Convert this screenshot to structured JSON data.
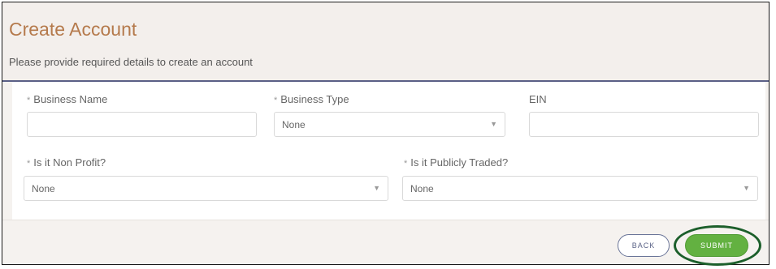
{
  "header": {
    "title": "Create Account",
    "subtitle": "Please provide required details to create an account"
  },
  "form": {
    "required_marker": "*",
    "business_name": {
      "label": "Business Name",
      "value": ""
    },
    "business_type": {
      "label": "Business Type",
      "selected": "None"
    },
    "ein": {
      "label": "EIN",
      "value": ""
    },
    "non_profit": {
      "label": "Is it Non Profit?",
      "selected": "None"
    },
    "publicly_traded": {
      "label": "Is it Publicly Traded?",
      "selected": "None"
    }
  },
  "footer": {
    "back_label": "BACK",
    "submit_label": "SUBMIT"
  },
  "icons": {
    "dropdown": "chevron-down-icon"
  },
  "colors": {
    "title": "#b57a4c",
    "divider": "#5a5f86",
    "submit_bg": "#63b141",
    "highlight_ring": "#1c5f2b"
  }
}
